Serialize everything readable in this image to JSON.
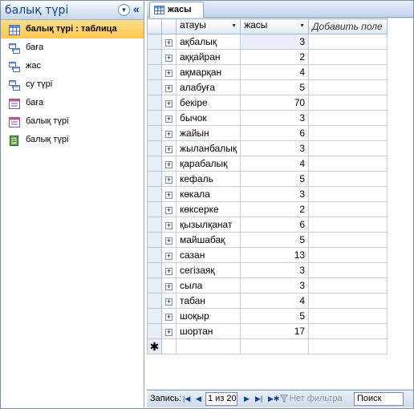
{
  "nav": {
    "title": "балық түрі",
    "menu_glyph": "▼",
    "collapse_glyph": "«",
    "items": [
      {
        "label": "балық түрі : таблица",
        "icon": "table-icon",
        "selected": true
      },
      {
        "label": "баға",
        "icon": "query-icon",
        "selected": false
      },
      {
        "label": "жас",
        "icon": "query-icon",
        "selected": false
      },
      {
        "label": "су түрі",
        "icon": "query-icon",
        "selected": false
      },
      {
        "label": "баға",
        "icon": "form-icon",
        "selected": false
      },
      {
        "label": "балық түрі",
        "icon": "form-icon",
        "selected": false
      },
      {
        "label": "балық түрі",
        "icon": "report-icon",
        "selected": false
      }
    ]
  },
  "tab": {
    "label": "жасы",
    "icon": "table-icon"
  },
  "grid": {
    "columns": [
      {
        "label": "атауы",
        "has_dropdown": true
      },
      {
        "label": "жасы",
        "has_dropdown": true
      },
      {
        "label": "Добавить поле",
        "has_dropdown": false
      }
    ],
    "expand_glyph": "+",
    "new_row_glyph": "✱",
    "rows": [
      {
        "name": "ақбалық",
        "age": "3"
      },
      {
        "name": "аққайран",
        "age": "2"
      },
      {
        "name": "ақмарқан",
        "age": "4"
      },
      {
        "name": "алабуға",
        "age": "5"
      },
      {
        "name": "бекіре",
        "age": "70"
      },
      {
        "name": "бычок",
        "age": "3"
      },
      {
        "name": "жайын",
        "age": "6"
      },
      {
        "name": "жыланбалық",
        "age": "3"
      },
      {
        "name": "қарабалық",
        "age": "4"
      },
      {
        "name": "кефаль",
        "age": "5"
      },
      {
        "name": "көкала",
        "age": "3"
      },
      {
        "name": "көксерке",
        "age": "2"
      },
      {
        "name": "қызылқанат",
        "age": "6"
      },
      {
        "name": "майшабақ",
        "age": "5"
      },
      {
        "name": "сазан",
        "age": "13"
      },
      {
        "name": "сегізаяқ",
        "age": "3"
      },
      {
        "name": "сыла",
        "age": "3"
      },
      {
        "name": "табан",
        "age": "4"
      },
      {
        "name": "шоқыр",
        "age": "5"
      },
      {
        "name": "шортан",
        "age": "17"
      }
    ]
  },
  "record_nav": {
    "label": "Запись:",
    "first_glyph": "|◀",
    "prev_glyph": "◀",
    "position": "1 из 20",
    "next_glyph": "▶",
    "last_glyph": "▶|",
    "new_glyph": "▶✱",
    "filter_label": "Нет фильтра",
    "search_label": "Поиск"
  },
  "colors": {
    "selected_item": "#ffc94f",
    "header_text": "#15428b",
    "pane_border": "#8ea2bd"
  }
}
